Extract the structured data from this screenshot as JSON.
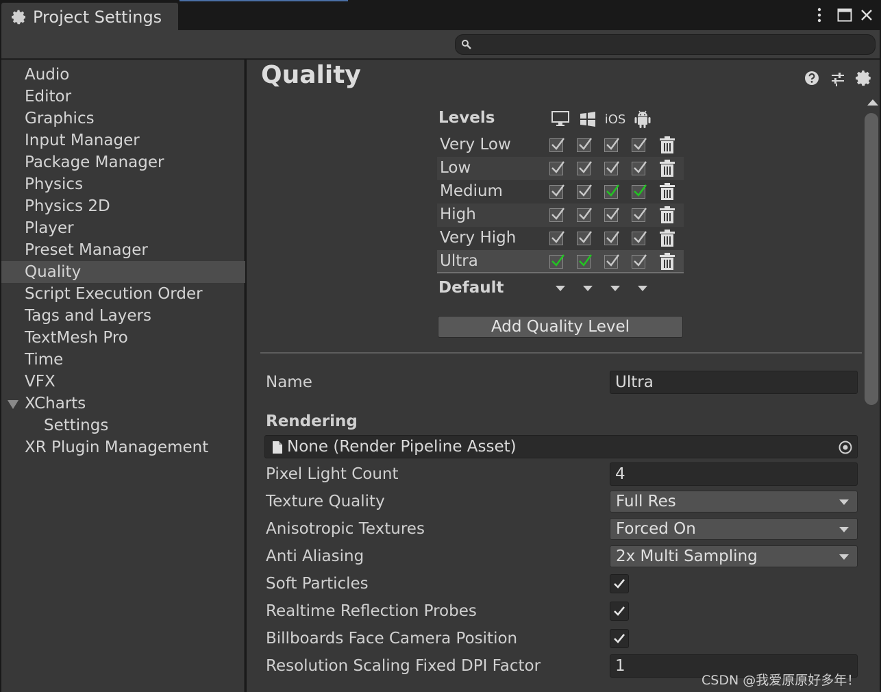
{
  "window": {
    "tab_title": "Project Settings",
    "icons": [
      "gear-icon",
      "kebab-menu-icon",
      "maximize-icon",
      "close-icon"
    ]
  },
  "search": {
    "placeholder": "",
    "value": ""
  },
  "sidebar": {
    "items": [
      {
        "label": "Audio"
      },
      {
        "label": "Editor"
      },
      {
        "label": "Graphics"
      },
      {
        "label": "Input Manager"
      },
      {
        "label": "Package Manager"
      },
      {
        "label": "Physics"
      },
      {
        "label": "Physics 2D"
      },
      {
        "label": "Player"
      },
      {
        "label": "Preset Manager"
      },
      {
        "label": "Quality",
        "selected": true
      },
      {
        "label": "Script Execution Order"
      },
      {
        "label": "Tags and Layers"
      },
      {
        "label": "TextMesh Pro"
      },
      {
        "label": "Time"
      },
      {
        "label": "VFX"
      },
      {
        "label": "XCharts",
        "expanded": true
      },
      {
        "label": "Settings",
        "child": true
      },
      {
        "label": "XR Plugin Management"
      }
    ]
  },
  "main": {
    "title": "Quality",
    "header_icons": [
      "help-icon",
      "preset-sliders-icon",
      "settings-gear-icon"
    ],
    "levels": {
      "header": "Levels",
      "platforms": [
        "desktop-icon",
        "windows-icon",
        "iOS",
        "android-icon"
      ],
      "rows": [
        {
          "name": "Very Low",
          "checks": [
            false,
            false,
            false,
            false
          ]
        },
        {
          "name": "Low",
          "checks": [
            false,
            false,
            false,
            false
          ]
        },
        {
          "name": "Medium",
          "checks": [
            false,
            false,
            true,
            true
          ]
        },
        {
          "name": "High",
          "checks": [
            false,
            false,
            false,
            false
          ]
        },
        {
          "name": "Very High",
          "checks": [
            false,
            false,
            false,
            false
          ]
        },
        {
          "name": "Ultra",
          "checks": [
            true,
            true,
            false,
            false
          ],
          "selected": true
        }
      ],
      "default_label": "Default",
      "add_button": "Add Quality Level"
    },
    "properties": {
      "name_label": "Name",
      "name_value": "Ultra",
      "rendering_header": "Rendering",
      "render_pipeline_asset": "None (Render Pipeline Asset)",
      "pixel_light_count_label": "Pixel Light Count",
      "pixel_light_count_value": "4",
      "texture_quality_label": "Texture Quality",
      "texture_quality_value": "Full Res",
      "anisotropic_label": "Anisotropic Textures",
      "anisotropic_value": "Forced On",
      "anti_aliasing_label": "Anti Aliasing",
      "anti_aliasing_value": "2x Multi Sampling",
      "soft_particles_label": "Soft Particles",
      "soft_particles_checked": true,
      "realtime_reflection_label": "Realtime Reflection Probes",
      "realtime_reflection_checked": true,
      "billboards_label": "Billboards Face Camera Position",
      "billboards_checked": true,
      "resolution_scaling_label": "Resolution Scaling Fixed DPI Factor",
      "resolution_scaling_value": "1"
    }
  },
  "watermark": "CSDN @我爱原原好多年！",
  "colors": {
    "background": "#383838",
    "selected_row": "#4d4d4d",
    "field": "#2a2a2a",
    "check_green": "#22c422"
  }
}
